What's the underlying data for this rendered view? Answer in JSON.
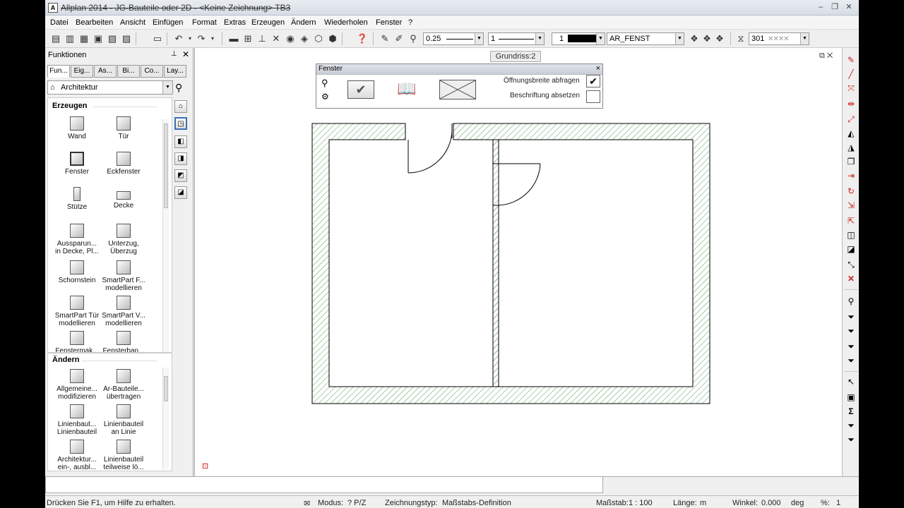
{
  "window": {
    "title": "Allplan 2014 - JG-Bauteile oder 2D - <Keine Zeichnung> TB3",
    "minimize": "–",
    "restore": "❐",
    "close": "✕"
  },
  "menu": [
    "Datei",
    "Bearbeiten",
    "Ansicht",
    "Einfügen",
    "Format",
    "Extras",
    "Erzeugen",
    "Ändern",
    "Wiederholen",
    "Fenster",
    "?"
  ],
  "toolbar": {
    "pen_value": "0.25",
    "line_value": "1",
    "color_value": "1",
    "layer_value": "AR_FENST",
    "pattern_value": "301"
  },
  "panel": {
    "title": "Funktionen",
    "pin": "⊥",
    "close": "✕",
    "tabs": [
      "Fun...",
      "Eig...",
      "As...",
      "Bi...",
      "Co...",
      "Lay..."
    ],
    "category": "Architektur",
    "section_create": "Erzeugen",
    "create_items": [
      {
        "l1": "Wand",
        "l2": ""
      },
      {
        "l1": "Tür",
        "l2": ""
      },
      {
        "l1": "Fenster",
        "l2": ""
      },
      {
        "l1": "Eckfenster",
        "l2": ""
      },
      {
        "l1": "Stütze",
        "l2": ""
      },
      {
        "l1": "Decke",
        "l2": ""
      },
      {
        "l1": "Aussparun...",
        "l2": "in Decke, Pl..."
      },
      {
        "l1": "Unterzug,",
        "l2": "Überzug"
      },
      {
        "l1": "Schornstein",
        "l2": ""
      },
      {
        "l1": "SmartPart F...",
        "l2": "modellieren"
      },
      {
        "l1": "SmartPart Tür",
        "l2": "modellieren"
      },
      {
        "l1": "SmartPart V...",
        "l2": "modellieren"
      },
      {
        "l1": "Fenstermak...",
        "l2": ""
      },
      {
        "l1": "Fensterban...",
        "l2": ""
      }
    ],
    "section_modify": "Ändern",
    "modify_items": [
      {
        "l1": "Allgemeine...",
        "l2": "modifizieren"
      },
      {
        "l1": "Ar-Bauteile...",
        "l2": "übertragen"
      },
      {
        "l1": "Linienbaut...",
        "l2": "Linienbauteil"
      },
      {
        "l1": "Linienbauteil",
        "l2": "an Linie"
      },
      {
        "l1": "Architektur...",
        "l2": "ein-, ausbl..."
      },
      {
        "l1": "Linienbauteil",
        "l2": "teilweise lö..."
      }
    ]
  },
  "canvas": {
    "view_tab": "Grundriss:2",
    "corner_buttons": "⧉ ✕"
  },
  "dialog": {
    "title": "Fenster",
    "close": "×",
    "option1": "Öffnungsbreite abfragen",
    "option1_mark": "✔",
    "option2": "Beschriftung absetzen",
    "option2_mark": ""
  },
  "status": {
    "help": "Drücken Sie F1, um Hilfe zu erhalten.",
    "mode_label": "Modus:",
    "mode_value": "? P/Z",
    "drawtype_label": "Zeichnungstyp:",
    "drawtype_value": "Maßstabs-Definition",
    "scale_label": "Maßstab:",
    "scale_value": "1 : 100",
    "length_label": "Länge:",
    "length_value": "m",
    "angle_label": "Winkel:",
    "angle_value": "0.000",
    "angle_unit": "deg",
    "percent_label": "%:",
    "percent_value": "1"
  },
  "colors": {
    "hatch": "#5a9e5a",
    "wall_outline": "#000000",
    "accent_red": "#cc2222"
  }
}
